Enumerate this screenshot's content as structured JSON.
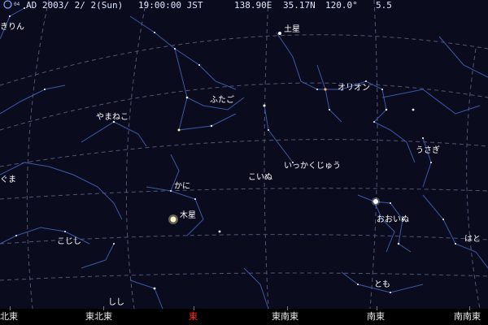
{
  "status_bar": {
    "moon_age": "04",
    "date": "AD 2003/ 2/ 2(Sun)",
    "time": "19:00:00 JST",
    "longitude": "138.90E",
    "latitude": "35.17N",
    "field_of_view": "120.0°",
    "limiting_magnitude": "5.5"
  },
  "constellations": {
    "kirin": "きりん",
    "yamaneko": "やまねこ",
    "futago": "ふたご",
    "orion": "オリオン",
    "usagi": "うさぎ",
    "ikkakujuu": "いっかくじゅう",
    "koinu": "こいぬ",
    "kani": "かに",
    "kuma_partial": "ぐま",
    "ooinu": "おおいぬ",
    "koshishi": "こじし",
    "hato": "はと",
    "tomo": "とも",
    "shishi": "しし"
  },
  "planets": {
    "saturn": "土星",
    "jupiter": "木星"
  },
  "horizon": {
    "directions": [
      "北東",
      "東北東",
      "東",
      "東南東",
      "南東",
      "南南東"
    ],
    "selected": "東"
  },
  "colors": {
    "sky": "#0b0b1e",
    "constellation_line": "#3a5aa8",
    "grid_line": "#6a7090",
    "star": "#ffffff",
    "highlight_direction": "#ff2a1a"
  }
}
